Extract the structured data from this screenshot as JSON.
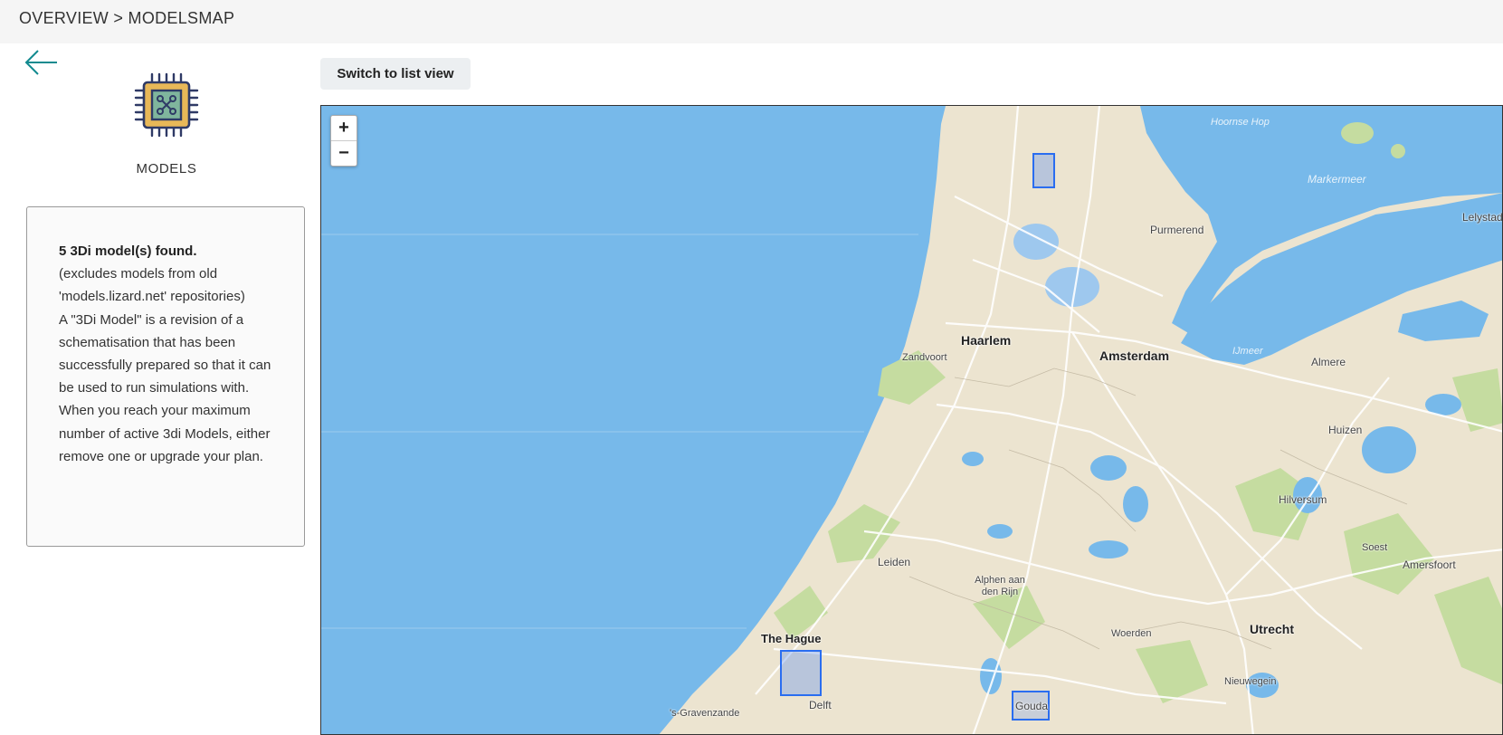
{
  "breadcrumb": {
    "overview": "OVERVIEW",
    "separator": ">",
    "current": "MODELSMAP"
  },
  "sidebar": {
    "back_icon": "arrow-left-icon",
    "logo_icon": "chip-icon",
    "section_label": "MODELS",
    "info": {
      "count_text": "5 3Di model(s) found.",
      "line1": "(excludes models from old 'models.lizard.net' repositories)",
      "line2": "A \"3Di Model\" is a revision of a schematisation that has been successfully prepared so that it can be used to run simulations with.",
      "line3": "When you reach your maximum number of active 3di Models, either remove one or upgrade your plan."
    }
  },
  "toolbar": {
    "switch_label": "Switch to list view"
  },
  "map": {
    "zoom_in": "+",
    "zoom_out": "−",
    "colors": {
      "water": "#77b9ea",
      "land": "#ece4d0",
      "green": "#c5dca0",
      "model_outline": "#2a6df0"
    },
    "labels": {
      "hoornse_hop": "Hoornse Hop",
      "markermeer": "Markermeer",
      "lelystad": "Lelystad",
      "purmerend": "Purmerend",
      "haarlem": "Haarlem",
      "amsterdam": "Amsterdam",
      "zandvoort": "Zandvoort",
      "ijmeer": "IJmeer",
      "almere": "Almere",
      "huizen": "Huizen",
      "hilversum": "Hilversum",
      "soest": "Soest",
      "amersfoort": "Amersfoort",
      "leiden": "Leiden",
      "alphen": "Alphen aan den Rijn",
      "woerden": "Woerden",
      "utrecht": "Utrecht",
      "the_hague": "The Hague",
      "nieuwegein": "Nieuwegein",
      "delft": "Delft",
      "gravenzande": "'s-Gravenzande",
      "gouda": "Gouda"
    }
  }
}
